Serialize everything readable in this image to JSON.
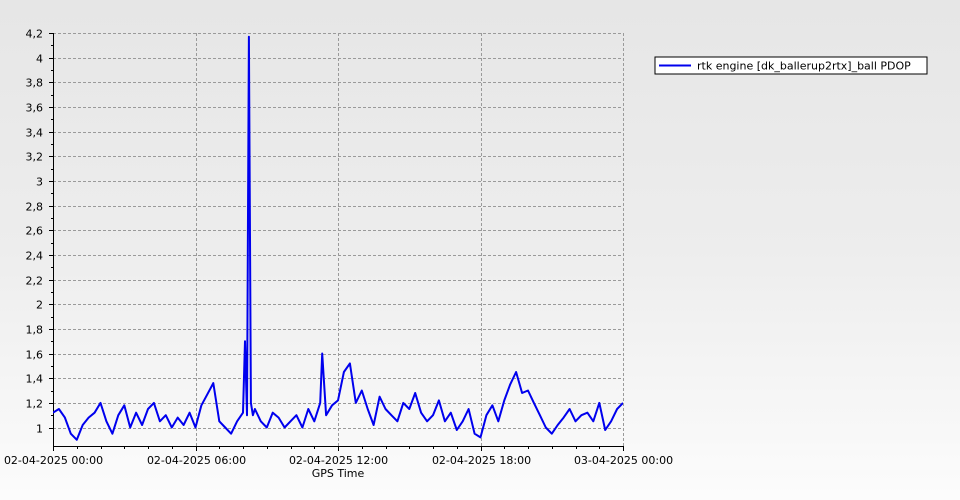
{
  "chart_data": {
    "type": "line",
    "title": "",
    "xlabel": "GPS Time",
    "ylabel": "",
    "xlim": [
      "2025-04-02T00:00",
      "2025-04-03T00:00"
    ],
    "ylim": [
      0.85,
      4.2
    ],
    "grid": true,
    "legend_position": "top-right",
    "x_tick_labels": [
      "02-04-2025 00:00",
      "02-04-2025 06:00",
      "02-04-2025 12:00",
      "02-04-2025 18:00",
      "03-04-2025 00:00"
    ],
    "x_tick_values": [
      "2025-04-02T00:00",
      "2025-04-02T06:00",
      "2025-04-02T12:00",
      "2025-04-02T18:00",
      "2025-04-03T00:00"
    ],
    "y_tick_labels": [
      "1",
      "1,2",
      "1,4",
      "1,6",
      "1,8",
      "2",
      "2,2",
      "2,4",
      "2,6",
      "2,8",
      "3",
      "3,2",
      "3,4",
      "3,6",
      "3,8",
      "4",
      "4,2"
    ],
    "y_tick_values": [
      1,
      1.2,
      1.4,
      1.6,
      1.8,
      2,
      2.2,
      2.4,
      2.6,
      2.8,
      3,
      3.2,
      3.4,
      3.6,
      3.8,
      4,
      4.2
    ],
    "series": [
      {
        "name": "rtk engine [dk_ballerup2rtx]_ball PDOP",
        "color": "#0000ee",
        "x": [
          "2025-04-02T00:00",
          "2025-04-02T00:15",
          "2025-04-02T00:30",
          "2025-04-02T00:45",
          "2025-04-02T01:00",
          "2025-04-02T01:15",
          "2025-04-02T01:30",
          "2025-04-02T01:45",
          "2025-04-02T02:00",
          "2025-04-02T02:15",
          "2025-04-02T02:30",
          "2025-04-02T02:45",
          "2025-04-02T03:00",
          "2025-04-02T03:15",
          "2025-04-02T03:30",
          "2025-04-02T03:45",
          "2025-04-02T04:00",
          "2025-04-02T04:15",
          "2025-04-02T04:30",
          "2025-04-02T04:45",
          "2025-04-02T05:00",
          "2025-04-02T05:15",
          "2025-04-02T05:30",
          "2025-04-02T05:45",
          "2025-04-02T06:00",
          "2025-04-02T06:15",
          "2025-04-02T06:30",
          "2025-04-02T06:45",
          "2025-04-02T07:00",
          "2025-04-02T07:15",
          "2025-04-02T07:30",
          "2025-04-02T07:45",
          "2025-04-02T08:00",
          "2025-04-02T08:05",
          "2025-04-02T08:10",
          "2025-04-02T08:15",
          "2025-04-02T08:20",
          "2025-04-02T08:25",
          "2025-04-02T08:30",
          "2025-04-02T08:45",
          "2025-04-02T09:00",
          "2025-04-02T09:15",
          "2025-04-02T09:30",
          "2025-04-02T09:45",
          "2025-04-02T10:00",
          "2025-04-02T10:15",
          "2025-04-02T10:30",
          "2025-04-02T10:45",
          "2025-04-02T11:00",
          "2025-04-02T11:15",
          "2025-04-02T11:20",
          "2025-04-02T11:30",
          "2025-04-02T11:45",
          "2025-04-02T12:00",
          "2025-04-02T12:15",
          "2025-04-02T12:30",
          "2025-04-02T12:45",
          "2025-04-02T13:00",
          "2025-04-02T13:15",
          "2025-04-02T13:30",
          "2025-04-02T13:45",
          "2025-04-02T14:00",
          "2025-04-02T14:15",
          "2025-04-02T14:30",
          "2025-04-02T14:45",
          "2025-04-02T15:00",
          "2025-04-02T15:15",
          "2025-04-02T15:30",
          "2025-04-02T15:45",
          "2025-04-02T16:00",
          "2025-04-02T16:15",
          "2025-04-02T16:30",
          "2025-04-02T16:45",
          "2025-04-02T17:00",
          "2025-04-02T17:15",
          "2025-04-02T17:30",
          "2025-04-02T17:45",
          "2025-04-02T18:00",
          "2025-04-02T18:15",
          "2025-04-02T18:30",
          "2025-04-02T18:45",
          "2025-04-02T19:00",
          "2025-04-02T19:15",
          "2025-04-02T19:30",
          "2025-04-02T19:45",
          "2025-04-02T20:00",
          "2025-04-02T20:15",
          "2025-04-02T20:30",
          "2025-04-02T20:45",
          "2025-04-02T21:00",
          "2025-04-02T21:15",
          "2025-04-02T21:30",
          "2025-04-02T21:45",
          "2025-04-02T22:00",
          "2025-04-02T22:15",
          "2025-04-02T22:30",
          "2025-04-02T22:45",
          "2025-04-02T23:00",
          "2025-04-02T23:15",
          "2025-04-02T23:30",
          "2025-04-02T23:45",
          "2025-04-03T00:00"
        ],
        "values": [
          1.12,
          1.15,
          1.08,
          0.95,
          0.9,
          1.02,
          1.08,
          1.12,
          1.2,
          1.05,
          0.95,
          1.1,
          1.18,
          1.0,
          1.12,
          1.02,
          1.15,
          1.2,
          1.05,
          1.1,
          1.0,
          1.08,
          1.02,
          1.12,
          1.0,
          1.18,
          1.27,
          1.36,
          1.05,
          1.0,
          0.95,
          1.05,
          1.12,
          1.7,
          1.1,
          4.17,
          1.2,
          1.1,
          1.15,
          1.05,
          1.0,
          1.12,
          1.08,
          1.0,
          1.05,
          1.1,
          1.0,
          1.15,
          1.05,
          1.2,
          1.6,
          1.1,
          1.18,
          1.22,
          1.45,
          1.52,
          1.2,
          1.3,
          1.15,
          1.02,
          1.25,
          1.15,
          1.1,
          1.05,
          1.2,
          1.15,
          1.28,
          1.12,
          1.05,
          1.1,
          1.22,
          1.05,
          1.12,
          0.98,
          1.05,
          1.15,
          0.95,
          0.92,
          1.1,
          1.18,
          1.05,
          1.22,
          1.35,
          1.45,
          1.28,
          1.3,
          1.2,
          1.1,
          1.0,
          0.95,
          1.02,
          1.08,
          1.15,
          1.05,
          1.1,
          1.12,
          1.05,
          1.2,
          0.98,
          1.05,
          1.15,
          1.2
        ]
      }
    ]
  }
}
